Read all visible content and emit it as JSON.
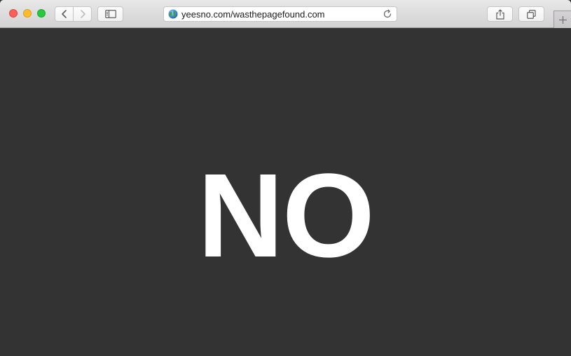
{
  "window": {
    "controls": [
      "close",
      "minimize",
      "maximize"
    ]
  },
  "toolbar": {
    "back_icon": "chevron-left-icon",
    "forward_icon": "chevron-right-icon",
    "sidebar_icon": "sidebar-icon",
    "share_icon": "share-icon",
    "tabs_icon": "tabs-overview-icon",
    "new_tab_icon": "plus-icon"
  },
  "address_bar": {
    "url": "yeesno.com/wasthepagefound.com",
    "site_icon": "globe-icon",
    "reload_icon": "reload-icon"
  },
  "page": {
    "answer": "NO",
    "background_color": "#333333",
    "text_color": "#ffffff"
  }
}
